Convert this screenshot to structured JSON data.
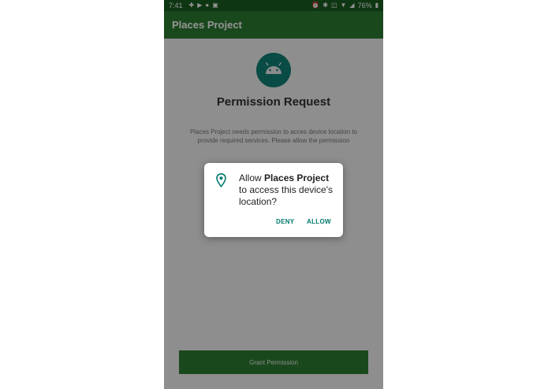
{
  "status_bar": {
    "time": "7:41",
    "battery": "76%"
  },
  "app_bar": {
    "title": "Places Project"
  },
  "main": {
    "heading": "Permission Request",
    "description": "Places Project needs permission to acces device location to provide required services. Please allow the permission",
    "grant_button": "Grant Permission"
  },
  "dialog": {
    "message_prefix": "Allow ",
    "app_name": "Places Project",
    "message_suffix": " to access this device's location?",
    "deny": "DENY",
    "allow": "ALLOW",
    "icon": "location-pin-icon"
  },
  "colors": {
    "status_bar": "#1b5e20",
    "app_bar": "#2e7d32",
    "accent": "#00796b",
    "logo_bg": "#0d7e74"
  }
}
